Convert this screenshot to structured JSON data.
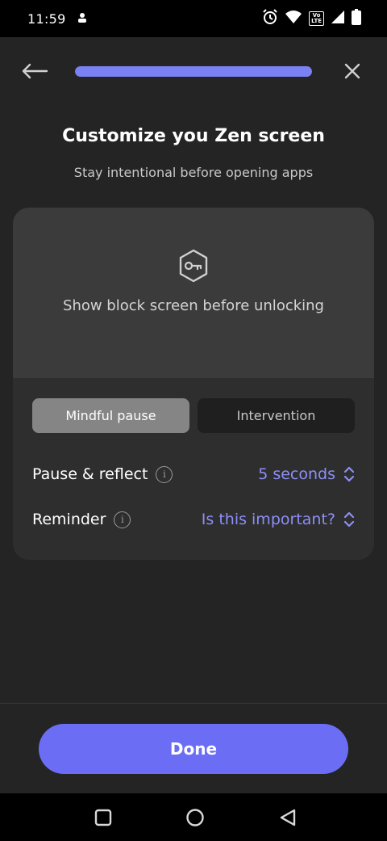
{
  "status_bar": {
    "time": "11:59",
    "lte_label_top": "Vo",
    "lte_label_bottom": "LTE"
  },
  "header": {
    "progress_percent": 100,
    "accent_color": "#7b80f5"
  },
  "page": {
    "title": "Customize you Zen screen",
    "subtitle": "Stay intentional before opening apps"
  },
  "card": {
    "icon": "key-icon",
    "headline": "Show block screen before unlocking",
    "tabs": [
      {
        "label": "Mindful pause",
        "active": true
      },
      {
        "label": "Intervention",
        "active": false
      }
    ],
    "settings": [
      {
        "label": "Pause & reflect",
        "value": "5 seconds"
      },
      {
        "label": "Reminder",
        "value": "Is this important?"
      }
    ]
  },
  "footer": {
    "done_label": "Done",
    "button_color": "#6b6ef5"
  },
  "info_glyph": "i"
}
